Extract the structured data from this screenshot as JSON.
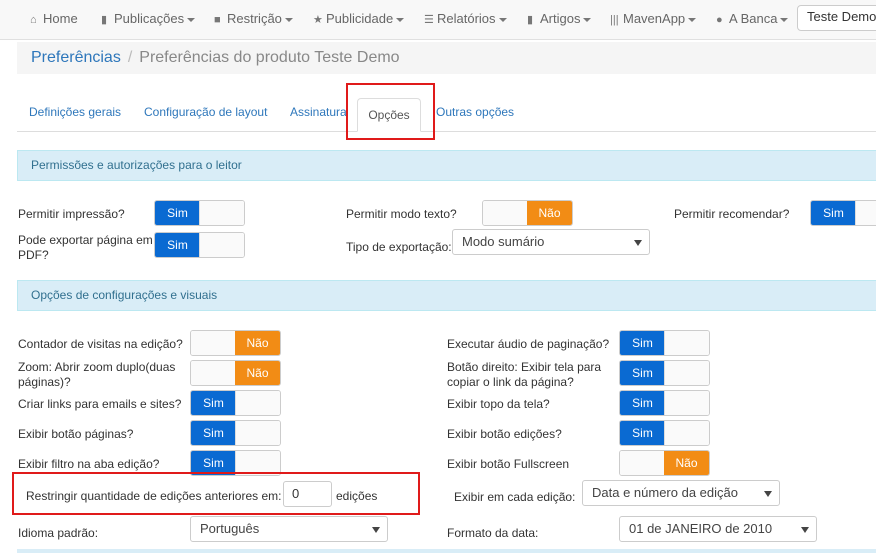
{
  "navbar": {
    "items": [
      {
        "icon": "home-icon",
        "label": "Home",
        "caret": false
      },
      {
        "icon": "book-icon",
        "label": "Publicações",
        "caret": true
      },
      {
        "icon": "lock-icon",
        "label": "Restrição",
        "caret": true
      },
      {
        "icon": "star-icon",
        "label": "Publicidade",
        "caret": true
      },
      {
        "icon": "list-icon",
        "label": "Relatórios",
        "caret": true
      },
      {
        "icon": "book-icon",
        "label": "Artigos",
        "caret": true
      },
      {
        "icon": "barcode-icon",
        "label": "MavenApp",
        "caret": true
      },
      {
        "icon": "globe-icon",
        "label": "A Banca",
        "caret": true
      }
    ],
    "search_value": "Teste Demo"
  },
  "breadcrumb": {
    "root": "Preferências",
    "separator": "/",
    "current": "Preferências do produto Teste Demo"
  },
  "tabs": {
    "items": [
      "Definições gerais",
      "Configuração de layout",
      "Assinatura",
      "Opções",
      "Outras opções"
    ],
    "active": "Opções"
  },
  "panels": {
    "reader_permissions": "Permissões e autorizações para o leitor",
    "visual_config": "Opções de configurações e visuais"
  },
  "toggle_text": {
    "on": "Sim",
    "off": "Não"
  },
  "reader": {
    "allow_print": {
      "label": "Permitir impressão?",
      "state": "on"
    },
    "allow_text_mode": {
      "label": "Permitir modo texto?",
      "state": "off"
    },
    "allow_recommend": {
      "label": "Permitir recomendar?",
      "state": "on"
    },
    "export_pdf": {
      "label": "Pode exportar página em PDF?",
      "state": "on"
    },
    "export_type": {
      "label": "Tipo de exportação:",
      "value": "Modo sumário"
    }
  },
  "visual": {
    "visit_counter": {
      "label": "Contador de visitas na edição?",
      "state": "off"
    },
    "zoom": {
      "label": "Zoom: Abrir zoom duplo(duas páginas)?",
      "state": "off"
    },
    "create_links": {
      "label": "Criar links para emails e sites?",
      "state": "on"
    },
    "pages_button": {
      "label": "Exibir botão páginas?",
      "state": "on"
    },
    "filter_tab": {
      "label": "Exibir filtro na aba edição?",
      "state": "on"
    },
    "page_audio": {
      "label": "Executar áudio de paginação?",
      "state": "on"
    },
    "right_button": {
      "label": "Botão direito: Exibir tela para copiar o link da página?",
      "state": "on"
    },
    "top_screen": {
      "label": "Exibir topo da tela?",
      "state": "on"
    },
    "editions_button": {
      "label": "Exibir botão edições?",
      "state": "on"
    },
    "fullscreen_button": {
      "label": "Exibir botão Fullscreen",
      "state": "off"
    },
    "restrict": {
      "label": "Restringir quantidade de edições anteriores em:",
      "value": "0",
      "suffix": "edições"
    },
    "each_edition": {
      "label": "Exibir em cada edição:",
      "value": "Data e número da edição"
    },
    "language": {
      "label": "Idioma padrão:",
      "value": "Português"
    },
    "date_format": {
      "label": "Formato da data:",
      "value": "01 de JANEIRO de 2010"
    }
  },
  "colors": {
    "toggle_on": "#0a6ad2",
    "toggle_off": "#f28c15",
    "panel_heading": "#d9edf7",
    "link": "#2e77bb",
    "highlight": "#e01a1a"
  }
}
